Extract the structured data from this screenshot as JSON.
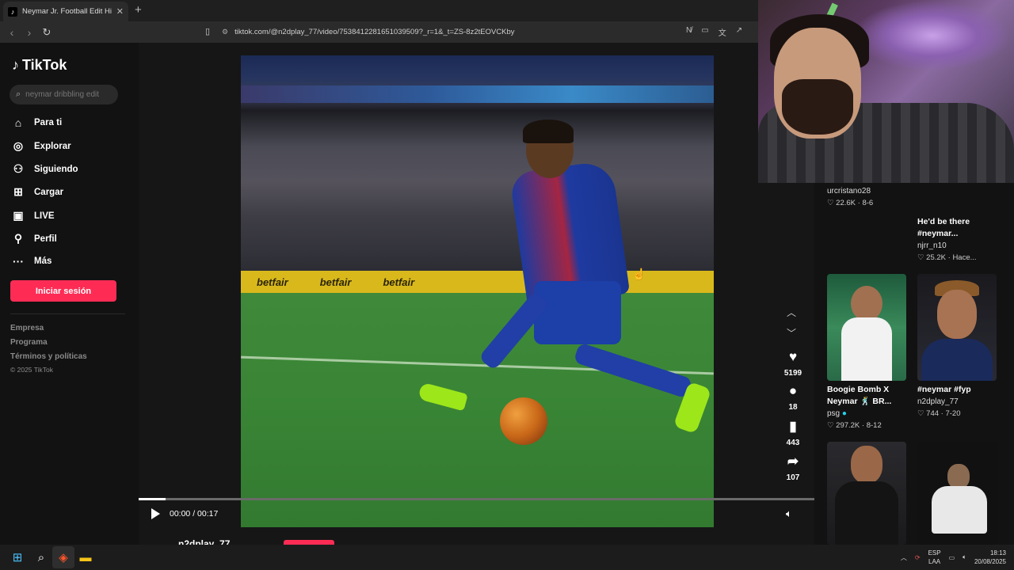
{
  "browser": {
    "tab_title": "Neymar Jr. Football Edit Highligh",
    "url": "tiktok.com/@n2dplay_77/video/7538412281651039509?_r=1&_t=ZS-8z2tEOVCKby"
  },
  "nav": {
    "logo": "TikTok",
    "search_placeholder": "neymar dribbling edit",
    "items": [
      {
        "label": "Para ti",
        "icon": "home-icon"
      },
      {
        "label": "Explorar",
        "icon": "compass-icon"
      },
      {
        "label": "Siguiendo",
        "icon": "following-icon"
      },
      {
        "label": "Cargar",
        "icon": "upload-icon"
      },
      {
        "label": "LIVE",
        "icon": "live-icon"
      },
      {
        "label": "Perfil",
        "icon": "profile-icon"
      },
      {
        "label": "Más",
        "icon": "more-icon"
      }
    ],
    "login": "Iniciar sesión",
    "footer": [
      "Empresa",
      "Programa",
      "Términos y políticas"
    ],
    "copyright": "© 2025 TikTok"
  },
  "player": {
    "time": "00:00 / 00:17",
    "progress": 0.04,
    "likes": "5199",
    "comments": "18",
    "saves": "443",
    "shares": "107",
    "author": "n2dplay_77",
    "adboard": [
      "betfair",
      "betfair",
      "betfair"
    ]
  },
  "recommendations": [
    {
      "user": "urcristano28",
      "caption": "",
      "likes": "22.6K",
      "date": "8-6"
    },
    {
      "user": "njrr_n10",
      "caption": "He'd be there #neymar...",
      "likes": "25.2K",
      "date": "Hace..."
    },
    {
      "user": "psg",
      "caption": "Boogie Bomb X Neymar 🕺 BR...",
      "likes": "297.2K",
      "date": "8-12"
    },
    {
      "user": "n2dplay_77",
      "caption": "#neymar #fyp",
      "likes": "744",
      "date": "7-20"
    }
  ],
  "taskbar": {
    "lang": "ESP",
    "region": "LAA",
    "time": "18:13",
    "date": "20/08/2025"
  }
}
